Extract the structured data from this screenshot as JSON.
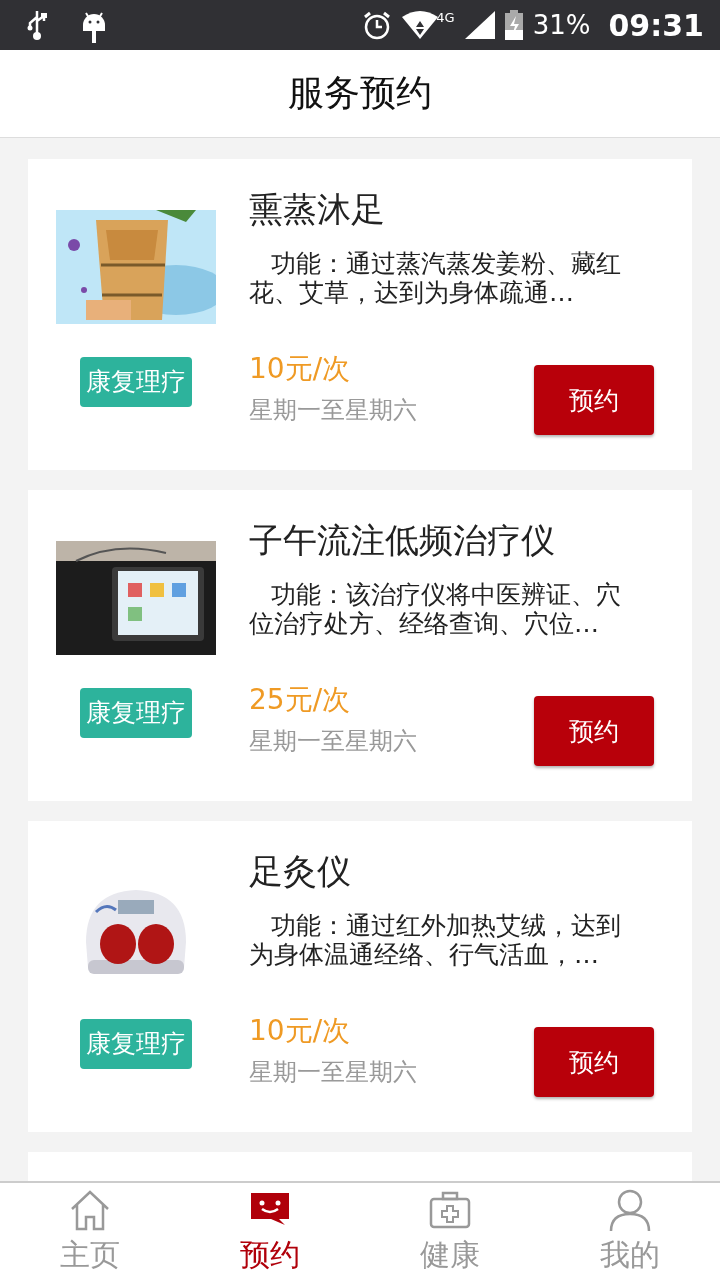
{
  "status_bar": {
    "network": "4G",
    "battery": "31%",
    "time": "09:31"
  },
  "header": {
    "title": "服务预约"
  },
  "services": [
    {
      "title": "熏蒸沐足",
      "description": "功能：通过蒸汽蒸发姜粉、藏红花、艾草，达到为身体疏通…",
      "tag": "康复理疗",
      "price": "10元/次",
      "schedule": "星期一至星期六",
      "button": "预约"
    },
    {
      "title": "子午流注低频治疗仪",
      "description": "功能：该治疗仪将中医辨证、穴位治疗处方、经络查询、穴位…",
      "tag": "康复理疗",
      "price": "25元/次",
      "schedule": "星期一至星期六",
      "button": "预约"
    },
    {
      "title": "足灸仪",
      "description": "功能：通过红外加热艾绒，达到为身体温通经络、行气活血，…",
      "tag": "康复理疗",
      "price": "10元/次",
      "schedule": "星期一至星期六",
      "button": "预约"
    }
  ],
  "tab_bar": [
    {
      "label": "主页",
      "selected": false
    },
    {
      "label": "预约",
      "selected": true
    },
    {
      "label": "健康",
      "selected": false
    },
    {
      "label": "我的",
      "selected": false
    }
  ]
}
